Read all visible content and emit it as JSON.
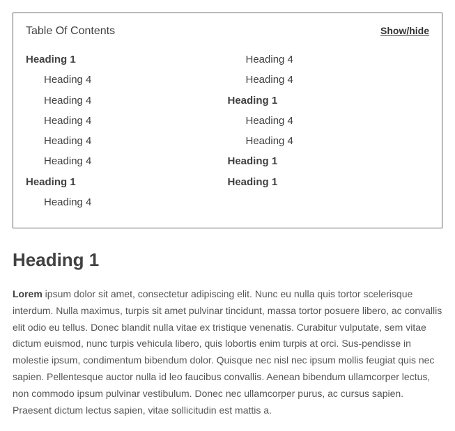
{
  "toc": {
    "title": "Table Of Contents",
    "toggle_label": "Show/hide",
    "columns": [
      [
        {
          "label": "Heading 1",
          "level": 1
        },
        {
          "label": "Heading 4",
          "level": 4
        },
        {
          "label": "Heading 4",
          "level": 4
        },
        {
          "label": "Heading 4",
          "level": 4
        },
        {
          "label": "Heading 4",
          "level": 4
        },
        {
          "label": "Heading 4",
          "level": 4
        },
        {
          "label": "Heading 1",
          "level": 1
        },
        {
          "label": "Heading 4",
          "level": 4
        }
      ],
      [
        {
          "label": "Heading 4",
          "level": 4
        },
        {
          "label": "Heading 4",
          "level": 4
        },
        {
          "label": "Heading 1",
          "level": 1
        },
        {
          "label": "Heading 4",
          "level": 4
        },
        {
          "label": "Heading 4",
          "level": 4
        },
        {
          "label": "Heading 1",
          "level": 1
        },
        {
          "label": "Heading 1",
          "level": 1
        }
      ]
    ]
  },
  "content": {
    "heading": "Heading 1",
    "lead_word": "Lorem",
    "body": " ipsum dolor sit amet, consectetur adipiscing elit. Nunc eu nulla quis tortor scelerisque interdum. Nulla maximus, turpis sit amet pulvinar tincidunt, massa tortor posuere libero, ac convallis elit odio eu tellus. Donec blandit nulla vitae ex tristique venenatis. Curabitur vulputate, sem vitae dictum euismod, nunc turpis vehicula libero, quis lobortis enim turpis at orci. Sus-pendisse in molestie ipsum, condimentum bibendum dolor. Quisque nec nisl nec ipsum mollis feugiat quis nec sapien. Pellentesque auctor nulla id leo faucibus convallis. Aenean bibendum ullamcorper lectus, non commodo ipsum pulvinar vestibulum. Donec nec ullamcorper purus, ac cursus sapien. Praesent dictum lectus sapien, vitae sollicitudin est mattis a."
  }
}
